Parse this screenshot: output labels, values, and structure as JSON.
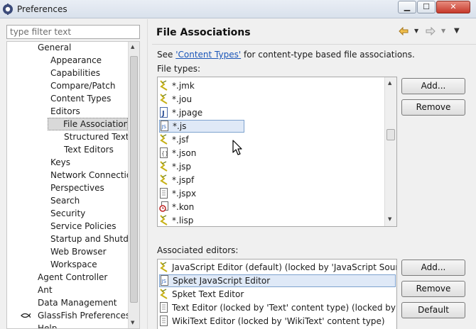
{
  "window": {
    "title": "Preferences",
    "minimize": "▁",
    "maximize": "☐",
    "close": "✕"
  },
  "filter": {
    "placeholder": "type filter text"
  },
  "tree": {
    "items": [
      {
        "label": "General"
      },
      {
        "label": "Appearance"
      },
      {
        "label": "Capabilities"
      },
      {
        "label": "Compare/Patch"
      },
      {
        "label": "Content Types"
      },
      {
        "label": "Editors"
      },
      {
        "label": "File Associations"
      },
      {
        "label": "Structured Text E"
      },
      {
        "label": "Text Editors"
      },
      {
        "label": "Keys"
      },
      {
        "label": "Network Connection"
      },
      {
        "label": "Perspectives"
      },
      {
        "label": "Search"
      },
      {
        "label": "Security"
      },
      {
        "label": "Service Policies"
      },
      {
        "label": "Startup and Shutdo"
      },
      {
        "label": "Web Browser"
      },
      {
        "label": "Workspace"
      },
      {
        "label": "Agent Controller"
      },
      {
        "label": "Ant"
      },
      {
        "label": "Data Management"
      },
      {
        "label": "GlassFish Preferences"
      },
      {
        "label": "Help"
      }
    ],
    "selected": "File Associations"
  },
  "page": {
    "title": "File Associations",
    "desc_prefix": "See ",
    "desc_link": "'Content Types'",
    "desc_suffix": " for content-type based file associations.",
    "file_types_label": "File types:",
    "associated_label": "Associated editors:"
  },
  "file_types": [
    {
      "name": "*.jmk",
      "icon": "text-file-icon"
    },
    {
      "name": "*.jou",
      "icon": "text-file-icon"
    },
    {
      "name": "*.jpage",
      "icon": "java-file-icon"
    },
    {
      "name": "*.js",
      "icon": "js-file-icon"
    },
    {
      "name": "*.jsf",
      "icon": "text-file-icon"
    },
    {
      "name": "*.json",
      "icon": "json-file-icon"
    },
    {
      "name": "*.jsp",
      "icon": "text-file-icon"
    },
    {
      "name": "*.jspf",
      "icon": "text-file-icon"
    },
    {
      "name": "*.jspx",
      "icon": "plain-file-icon"
    },
    {
      "name": "*.kon",
      "icon": "kon-file-icon"
    },
    {
      "name": "*.lisp",
      "icon": "text-file-icon"
    }
  ],
  "editors": [
    {
      "name": "JavaScript Editor (default) (locked by 'JavaScript Source File'",
      "icon": "text-file-icon"
    },
    {
      "name": "Spket JavaScript Editor",
      "icon": "js-file-icon"
    },
    {
      "name": "Spket Text Editor",
      "icon": "text-file-icon"
    },
    {
      "name": "Text Editor (locked by 'Text' content type) (locked by 'JavaS",
      "icon": "plain-file-icon"
    },
    {
      "name": "WikiText Editor (locked by 'WikiText' content type)",
      "icon": "plain-file-icon"
    }
  ],
  "buttons": {
    "add": "Add...",
    "remove": "Remove",
    "add2": "Add...",
    "remove2": "Remove",
    "default": "Default"
  },
  "selected_file_type": "*.js",
  "selected_editor": "Spket JavaScript Editor",
  "colors": {
    "link": "#1a55b8",
    "selection": "#dfe9f7",
    "tree_selection": "#d9d9d9",
    "nav_arrow": "#e8a317"
  }
}
